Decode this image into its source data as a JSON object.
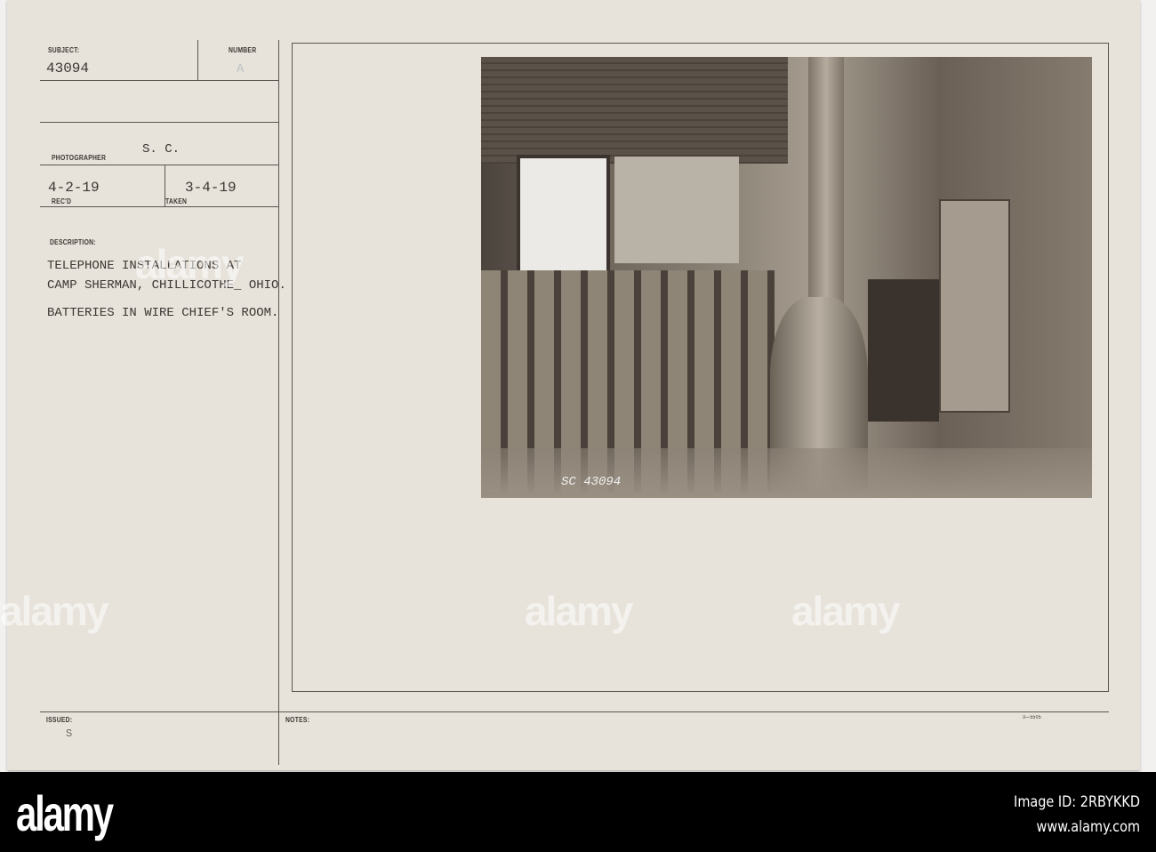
{
  "card": {
    "subject_label": "SUBJECT:",
    "subject_value": "43094",
    "number_label": "NUMBER",
    "number_value": "A",
    "photographer_label": "PHOTOGRAPHER",
    "photographer_value": "S. C.",
    "recd_value": "4-2-19",
    "recd_label": "REC'D",
    "taken_value": "3-4-19",
    "taken_label": "TAKEN",
    "description_label": "DESCRIPTION:",
    "description_lines": [
      "TELEPHONE INSTALLATIONS AT",
      "CAMP SHERMAN, CHILLICOTHE_ OHIO.",
      "BATTERIES IN WIRE CHIEF'S ROOM."
    ],
    "issued_label": "ISSUED:",
    "issued_value": "S",
    "notes_label": "NOTES:",
    "form_number": "3—5505",
    "photo_annotation": "SC 43094"
  },
  "watermark": "alamy",
  "footer": {
    "logo": "alamy",
    "image_id": "Image ID: 2RBYKKD",
    "website": "www.alamy.com"
  }
}
